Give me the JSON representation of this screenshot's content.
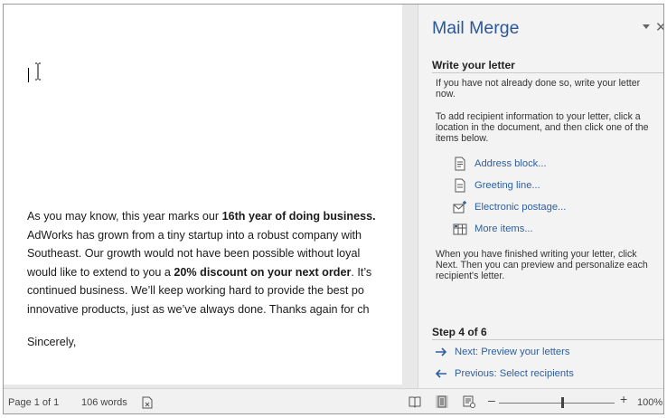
{
  "document": {
    "lines": [
      {
        "parts": [
          {
            "text": "As you may know, this year marks our ",
            "bold": false
          },
          {
            "text": "16th year of doing business.",
            "bold": true
          }
        ]
      },
      {
        "parts": [
          {
            "text": "AdWorks has grown from a tiny startup into a robust company with",
            "bold": false
          }
        ]
      },
      {
        "parts": [
          {
            "text": "Southeast. Our growth would not have been possible without loyal",
            "bold": false
          }
        ]
      },
      {
        "parts": [
          {
            "text": "would like to extend to you a ",
            "bold": false
          },
          {
            "text": "20% discount on your next order",
            "bold": true
          },
          {
            "text": ". It’s",
            "bold": false
          }
        ]
      },
      {
        "parts": [
          {
            "text": "continued business. We’ll keep working hard to provide the best po",
            "bold": false
          }
        ]
      },
      {
        "parts": [
          {
            "text": "innovative products, just as we’ve always done. Thanks again for ch",
            "bold": false
          }
        ]
      }
    ],
    "closing": "Sincerely,"
  },
  "pane": {
    "title": "Mail Merge",
    "section_title": "Write your letter",
    "intro": "If you have not already done so, write your letter now.",
    "instructions": "To add recipient information to your letter, click a location in the document, and then click one of the items below.",
    "items": [
      {
        "label": "Address block...",
        "icon": "address-block-icon"
      },
      {
        "label": "Greeting line...",
        "icon": "greeting-line-icon"
      },
      {
        "label": "Electronic postage...",
        "icon": "electronic-postage-icon"
      },
      {
        "label": "More items...",
        "icon": "more-items-icon"
      }
    ],
    "finish_text": "When you have finished writing your letter, click Next. Then you can preview and personalize each recipient's letter.",
    "step_label": "Step 4 of 6",
    "next_label": "Next: Preview your letters",
    "prev_label": "Previous: Select recipients"
  },
  "status": {
    "page": "Page 1 of 1",
    "words": "106 words",
    "zoom": "100%",
    "zoom_minus": "–",
    "zoom_plus": "+"
  },
  "colors": {
    "accent": "#2b5797",
    "link": "#2e5f9e"
  }
}
